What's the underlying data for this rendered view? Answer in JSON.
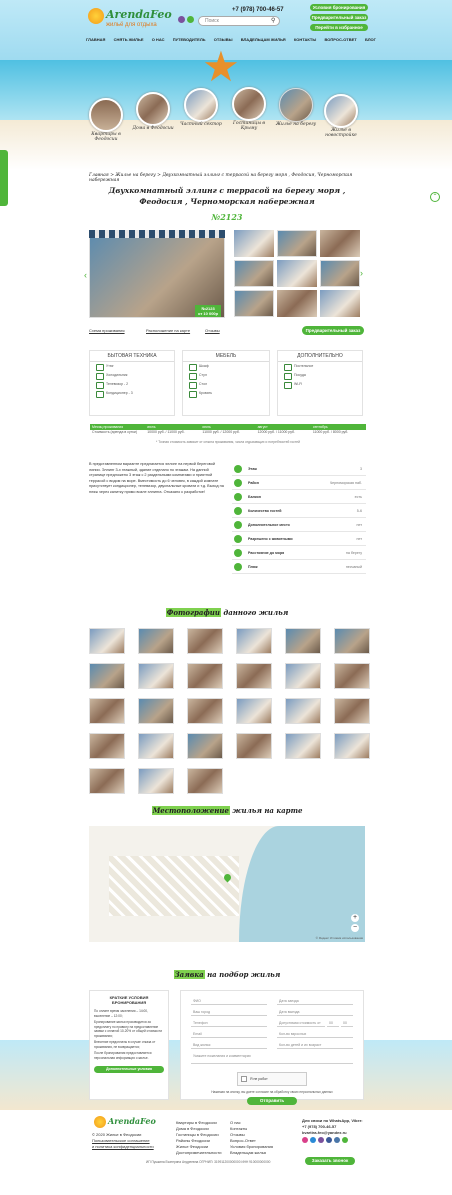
{
  "header": {
    "logo_main": "ArendaFeo",
    "logo_sub": "жильё для отдыха",
    "search_placeholder": "Поиск",
    "phone": "+7 (978) 700-46-57",
    "side_buttons": [
      "Условия бронирования",
      "Предварительный заказ",
      "Перейти в избранное"
    ]
  },
  "nav": [
    "ГЛАВНАЯ",
    "СНЯТЬ ЖИЛЬЕ",
    "О НАС",
    "ПУТЕВОДИТЕЛЬ",
    "ОТЗЫВЫ",
    "ВЛАДЕЛЬЦАМ ЖИЛЬЯ",
    "КОНТАКТЫ",
    "ВОПРОС-ОТВЕТ",
    "БЛОГ"
  ],
  "categories": [
    {
      "label": "Квартиры в Феодосии"
    },
    {
      "label": "Дома в Феодосии"
    },
    {
      "label": "Частный сектор"
    },
    {
      "label": "Гостиницы в Крыму"
    },
    {
      "label": "Жилье на берегу"
    },
    {
      "label": "Жилье в новостройке"
    }
  ],
  "breadcrumb": "Главная > Жилье на берегу > Двухкомнатный эллинг с террасой на берегу моря , Феодосия, Черноморская набережная",
  "title": "Двухкомнатный эллинг с террасой на берегу моря , Феодосия , Черноморская набережная",
  "number": "№2123",
  "photo_badge": {
    "num": "№2123",
    "price": "от 10 000р"
  },
  "links": {
    "scheme": "Схема проживания",
    "location": "Расположение на карте",
    "reviews": "Отзывы",
    "order": "Предварительный заказ"
  },
  "amenities": [
    {
      "title": "БЫТОВАЯ ТЕХНИКА",
      "items": [
        "Утюг",
        "Холодильник",
        "Телевизор - 2",
        "Кондиционер - 3"
      ]
    },
    {
      "title": "МЕБЕЛЬ",
      "items": [
        "Шкаф",
        "Стул",
        "Стол",
        "Кровать"
      ]
    },
    {
      "title": "ДОПОЛНИТЕЛЬНО",
      "items": [
        "Постельное",
        "Посуда",
        "Wi-Fi"
      ]
    }
  ],
  "prices": {
    "headers": [
      "Месяц проживания",
      "июнь",
      "июль",
      "август",
      "сентябрь"
    ],
    "row": [
      "Стоимость (аренда в сутки)",
      "10000 руб. / 11000 руб.",
      "11000 руб. / 12000 руб.",
      "12000 руб. / 11000 руб.",
      "11000 руб. / 8000 руб."
    ],
    "note": "* Точная стоимость зависит от сезона проживания, числа отдыхающих и потребностей гостей"
  },
  "description": "В представленном варианте предлагается эллинг на первой береговой линии. Эллинг 3-х этажный, здание отделано по этажам. На данной странице предложено 3 этаж с 2 раздельными комнатами и приятной террасой с видом на море. Вместимость до 6 человек, в каждой комнате присутствует кондиционер, телевизор, двуспальные кровати и т.д. Выход на пляж через калитку прямо возле эллинга. Отказано к разработке!",
  "features": [
    {
      "k": "Этаж",
      "v": "3"
    },
    {
      "k": "Район",
      "v": "Черноморская наб."
    },
    {
      "k": "Балкон",
      "v": "есть"
    },
    {
      "k": "Количество гостей",
      "v": "5-6"
    },
    {
      "k": "Дополнительное место",
      "v": "нет"
    },
    {
      "k": "Разрешено с животными",
      "v": "нет"
    },
    {
      "k": "Расстояние до моря",
      "v": "на берегу"
    },
    {
      "k": "Пляж",
      "v": "песчаный"
    }
  ],
  "photos_title_hl": "Фотографии",
  "photos_title_rest": " данного жилья",
  "map_title_hl": "Местоположение",
  "map_title_rest": " жилья на карте",
  "map_credit": "© Яндекс Условия использования",
  "form_title_hl": "Заявка",
  "form_title_rest": " на подбор жилья",
  "booking": {
    "title": "КРАТКИЕ УСЛОВИЯ БРОНИРОВАНИЯ",
    "items": [
      "По оплате время заселения – 14:00, выселение – 12:00;",
      "Бронирование жилья производится за предоплату по правилу на предоставление заявки с оплатой 10-20% от общей стоимости проживания;",
      "Внесение предоплаты в случае отказа от проживания, не возвращается;",
      "После бронирования предоставляется персональная информация о жилье."
    ],
    "button": "Дополнительные условия бронирования"
  },
  "form": {
    "fields": [
      "ФИО",
      "Дата заезда",
      "Ваш город",
      "Дата выезда",
      "Телефон",
      "Допустимая стоимость от",
      "Email",
      "Кол-во взрослых",
      "Вид жилья",
      "Кол-во детей и их возраст"
    ],
    "min": "00",
    "max": "00",
    "comment": "Укажите пожелания и комментарии",
    "captcha": "Я не робот",
    "agree": "Нажимая на кнопку, вы даете согласие на обработку своих персональных данных",
    "submit": "Отправить"
  },
  "footer": {
    "col1": [
      "© 2020 Жилье в Феодосии",
      "Пользовательское соглашение",
      "и политика конфиденциальности"
    ],
    "col2": [
      "Квартиры в Феодосии",
      "Дома в Феодосии",
      "Гостиницы в Феодосии",
      "Районы Феодосии",
      "Жилье Феодосии",
      "Достопримечательности"
    ],
    "col3": [
      "О нас",
      "Контакты",
      "Отзывы",
      "Вопрос-Ответ",
      "Условия бронирования",
      "Владельцам жилья"
    ],
    "contact_title": "Для связи по WhatsApp, Viber:",
    "phone": "+7 (978) 700-46-57",
    "email": "kvartira-feo@yandex.ru",
    "button": "Заказать звонок",
    "copyright": "ИП Пушкина Екатерина Андреевна ОГРНИП: 319911200000000 ИНН 910000000000"
  },
  "colors": {
    "accent": "#4fb53a",
    "highlight": "#7fd14f"
  }
}
